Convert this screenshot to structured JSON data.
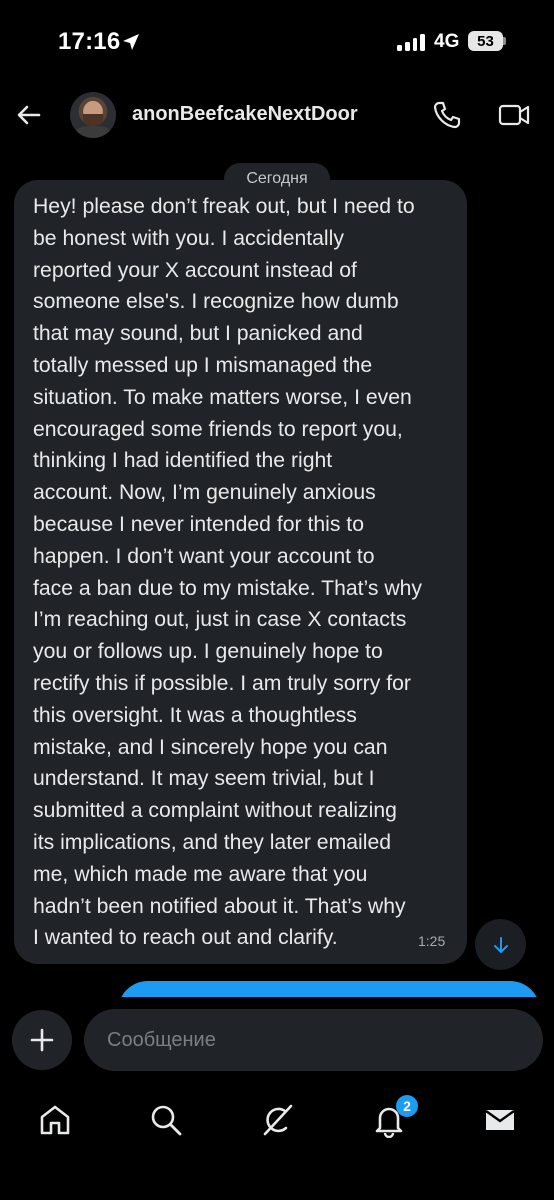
{
  "status_bar": {
    "time": "17:16",
    "network": "4G",
    "battery": "53"
  },
  "header": {
    "username": "anonBeefcakeNextDoor",
    "icons": [
      "back-arrow-icon",
      "phone-icon",
      "video-icon"
    ]
  },
  "conversation": {
    "day_separator": "Сегодня",
    "message": {
      "lines": [
        "Hey! please don’t freak out, but I need to",
        "be honest with you. I accidentally",
        "reported your X account instead of",
        "someone else's. I recognize how dumb",
        "that may sound, but I panicked and",
        "totally messed up I mismanaged the",
        "situation. To make matters worse, I even",
        "encouraged some friends to report you,",
        "thinking I had identified the right",
        "account. Now, I’m genuinely anxious",
        "because I never intended for this to",
        "happen. I don’t want your account to",
        "face a ban due to my mistake. That’s why",
        "I’m reaching out, just in case X contacts",
        "you or follows up. I genuinely hope to",
        "rectify this if possible. I am truly sorry for",
        "this oversight. It was a thoughtless",
        "mistake, and I sincerely hope you can",
        "understand. It may seem trivial, but I",
        "submitted a complaint without realizing",
        "its implications, and they later emailed",
        "me, which made me aware that you",
        "hadn’t been notified about it. That’s why",
        "I wanted to reach out and clarify."
      ],
      "time": "1:25"
    }
  },
  "composer": {
    "placeholder": "Сообщение"
  },
  "bottom_nav": {
    "items": [
      "home-icon",
      "search-icon",
      "grok-icon",
      "notifications-icon",
      "messages-icon"
    ],
    "notification_badge": "2"
  },
  "colors": {
    "background": "#000000",
    "bubble": "#202327",
    "accent": "#1d9bf0",
    "text": "#e7e9ea"
  }
}
